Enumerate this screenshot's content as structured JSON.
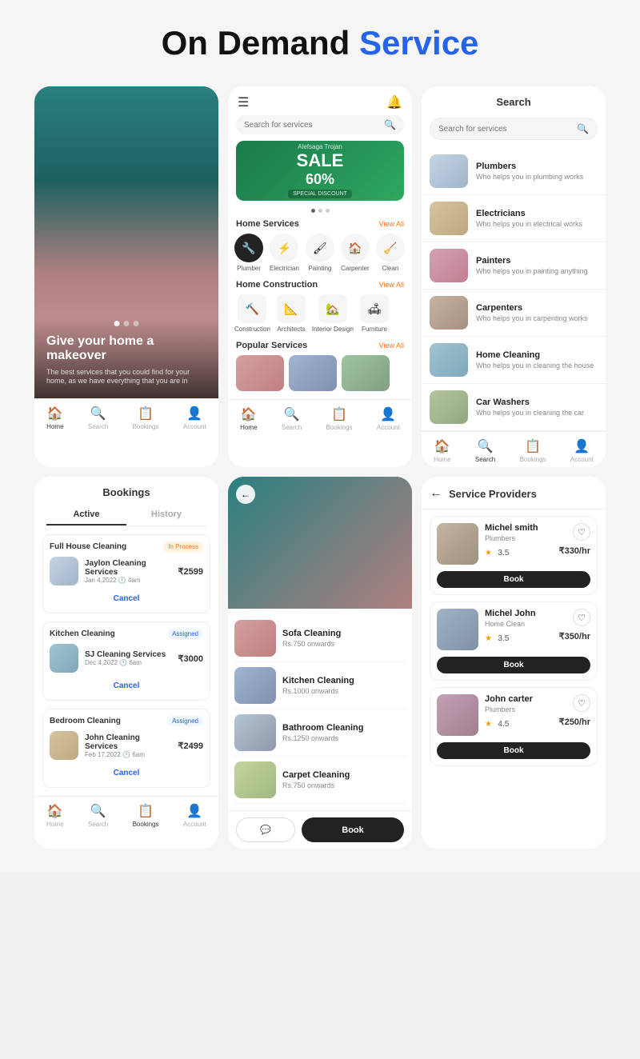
{
  "header": {
    "title_black": "On Demand",
    "title_blue": "Service"
  },
  "panel1": {
    "hero": {
      "title": "Give your home a makeover",
      "subtitle": "The best services that you could find for your home, as we have everything that you are in"
    },
    "nav": [
      {
        "label": "Home",
        "icon": "🏠",
        "active": true
      },
      {
        "label": "Search",
        "icon": "🔍",
        "active": false
      },
      {
        "label": "Bookings",
        "icon": "📋",
        "active": false
      },
      {
        "label": "Account",
        "icon": "👤",
        "active": false
      }
    ]
  },
  "panel2": {
    "search_placeholder": "Search for services",
    "banner": {
      "brand": "Alefsaga Trojan",
      "sale": "SALE",
      "discount": "60%",
      "tag": "SPECIAL DISCOUNT"
    },
    "home_services": {
      "title": "Home Services",
      "view_all": "View All",
      "items": [
        {
          "label": "Plumber",
          "icon": "🔧"
        },
        {
          "label": "Electrician",
          "icon": "⚡"
        },
        {
          "label": "Painting",
          "icon": "🖌"
        },
        {
          "label": "Carpenter",
          "icon": "🏠"
        },
        {
          "label": "Clean",
          "icon": "🧹"
        }
      ]
    },
    "home_construction": {
      "title": "Home Construction",
      "view_all": "View All",
      "items": [
        {
          "label": "Construction",
          "icon": "🔨"
        },
        {
          "label": "Architects",
          "icon": "📐"
        },
        {
          "label": "Interior Design",
          "icon": "🏡"
        },
        {
          "label": "Furniture",
          "icon": "🛋"
        }
      ]
    },
    "popular_services": {
      "title": "Popular Services",
      "view_all": "View All"
    },
    "nav": [
      {
        "label": "Home",
        "icon": "🏠",
        "active": true
      },
      {
        "label": "Search",
        "icon": "🔍",
        "active": false
      },
      {
        "label": "Bookings",
        "icon": "📋",
        "active": false
      },
      {
        "label": "Account",
        "icon": "👤",
        "active": false
      }
    ]
  },
  "panel3": {
    "title": "Search",
    "search_placeholder": "Search for services",
    "services": [
      {
        "name": "Plumbers",
        "desc": "Who helps you in plumbing works"
      },
      {
        "name": "Electricians",
        "desc": "Who helps you in electrical works"
      },
      {
        "name": "Painters",
        "desc": "Who helps you in painting anything"
      },
      {
        "name": "Carpenters",
        "desc": "Who helps you in carpenting works"
      },
      {
        "name": "Home Cleaning",
        "desc": "Who helps you in cleaning the house"
      },
      {
        "name": "Car Washers",
        "desc": "Who helps you in cleaning the car"
      }
    ],
    "nav": [
      {
        "label": "Home",
        "icon": "🏠",
        "active": false
      },
      {
        "label": "Search",
        "icon": "🔍",
        "active": true
      },
      {
        "label": "Bookings",
        "icon": "📋",
        "active": false
      },
      {
        "label": "Account",
        "icon": "👤",
        "active": false
      }
    ]
  },
  "panel4": {
    "title": "Bookings",
    "tabs": [
      "Active",
      "History"
    ],
    "active_tab": 0,
    "bookings": [
      {
        "type": "Full House Cleaning",
        "status": "In Process",
        "status_type": "inprocess",
        "service": "Jaylon Cleaning Services",
        "date": "Jan 4,2022 🕐 4am",
        "price": "₹2599"
      },
      {
        "type": "Kitchen Cleaning",
        "status": "Assigned",
        "status_type": "assigned",
        "service": "SJ Cleaning Services",
        "date": "Dec 4,2022 🕐 6am",
        "price": "₹3000"
      },
      {
        "type": "Bedroom Cleaning",
        "status": "Assigned",
        "status_type": "assigned",
        "service": "John Cleaning Services",
        "date": "Feb 17,2022 🕐 6am",
        "price": "₹2499"
      }
    ],
    "cancel_label": "Cancel",
    "nav": [
      {
        "label": "Home",
        "icon": "🏠",
        "active": false
      },
      {
        "label": "Search",
        "icon": "🔍",
        "active": false
      },
      {
        "label": "Bookings",
        "icon": "📋",
        "active": true
      },
      {
        "label": "Account",
        "icon": "👤",
        "active": false
      }
    ]
  },
  "panel5": {
    "cleaning_services": [
      {
        "name": "Sofa Cleaning",
        "price": "Rs.750 onwards"
      },
      {
        "name": "Kitchen Cleaning",
        "price": "Rs.1000 onwards"
      },
      {
        "name": "Bathroom Cleaning",
        "price": "Rs.1250 onwards"
      },
      {
        "name": "Carpet Cleaning",
        "price": "Rs.750 onwards"
      }
    ],
    "chat_btn": "💬",
    "book_btn": "Book"
  },
  "panel6": {
    "title": "Service Providers",
    "providers": [
      {
        "name": "Michel smith",
        "role": "Plumbers",
        "rating": "3.5",
        "price": "₹330/hr",
        "book": "Book"
      },
      {
        "name": "Michel John",
        "role": "Home Clean",
        "rating": "3.5",
        "price": "₹350/hr",
        "book": "Book"
      },
      {
        "name": "John carter",
        "role": "Plumbers",
        "rating": "4.5",
        "price": "₹250/hr",
        "book": "Book"
      }
    ]
  }
}
